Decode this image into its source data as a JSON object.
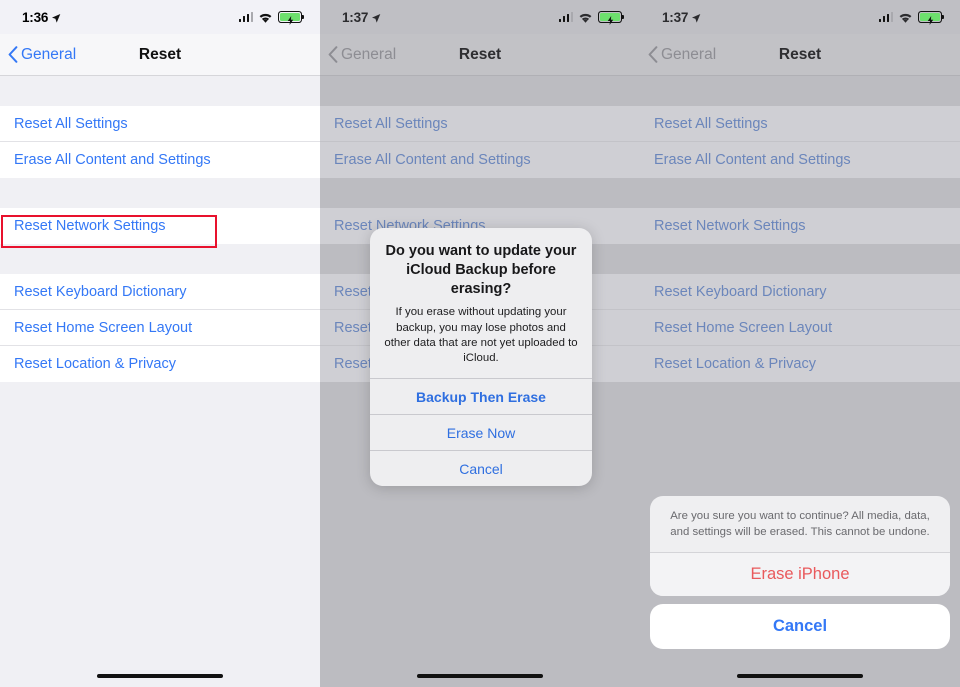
{
  "panels": [
    {
      "id": "panel-settings-list",
      "statusbar": {
        "time": "1:36",
        "location_icon": "location-arrow-icon",
        "signal_icon": "cellular-signal-icon",
        "wifi_icon": "wifi-icon",
        "battery_icon": "battery-charging-icon"
      },
      "navbar": {
        "back_label": "General",
        "back_icon": "chevron-left-icon",
        "title": "Reset"
      },
      "group1": [
        "Reset All Settings",
        "Erase All Content and Settings"
      ],
      "group2": [
        "Reset Network Settings"
      ],
      "group3": [
        "Reset Keyboard Dictionary",
        "Reset Home Screen Layout",
        "Reset Location & Privacy"
      ],
      "highlight": {
        "target": "Erase All Content and Settings",
        "color": "#e8112d"
      }
    },
    {
      "id": "panel-icloud-backup-alert",
      "statusbar": {
        "time": "1:37",
        "location_icon": "location-arrow-icon",
        "signal_icon": "cellular-signal-icon",
        "wifi_icon": "wifi-icon",
        "battery_icon": "battery-charging-icon"
      },
      "navbar": {
        "back_label": "General",
        "back_icon": "chevron-left-icon",
        "title": "Reset"
      },
      "group1": [
        "Reset All Settings",
        "Erase All Content and Settings"
      ],
      "group2": [
        "Reset Network Settings"
      ],
      "group3": [
        "Reset Keyboard Dictionary",
        "Reset Home Screen Layout",
        "Reset Location & Privacy"
      ],
      "alert": {
        "title": "Do you want to update your iCloud Backup before erasing?",
        "message": "If you erase without updating your backup, you may lose photos and other data that are not yet uploaded to iCloud.",
        "buttons": [
          {
            "label": "Backup Then Erase",
            "style": "default-bold"
          },
          {
            "label": "Erase Now",
            "style": "default"
          },
          {
            "label": "Cancel",
            "style": "default"
          }
        ]
      }
    },
    {
      "id": "panel-erase-confirm-sheet",
      "statusbar": {
        "time": "1:37",
        "location_icon": "location-arrow-icon",
        "signal_icon": "cellular-signal-icon",
        "wifi_icon": "wifi-icon",
        "battery_icon": "battery-charging-icon"
      },
      "navbar": {
        "back_label": "General",
        "back_icon": "chevron-left-icon",
        "title": "Reset"
      },
      "group1": [
        "Reset All Settings",
        "Erase All Content and Settings"
      ],
      "group2": [
        "Reset Network Settings"
      ],
      "group3": [
        "Reset Keyboard Dictionary",
        "Reset Home Screen Layout",
        "Reset Location & Privacy"
      ],
      "sheet": {
        "message": "Are you sure you want to continue? All media, data, and settings will be erased.\nThis cannot be undone.",
        "destructive_label": "Erase iPhone",
        "cancel_label": "Cancel"
      }
    }
  ],
  "colors": {
    "tint_blue": "#3478f6",
    "destructive_red": "#e9595c",
    "annotation_red": "#e8112d",
    "battery_green": "#6ddf6d"
  }
}
